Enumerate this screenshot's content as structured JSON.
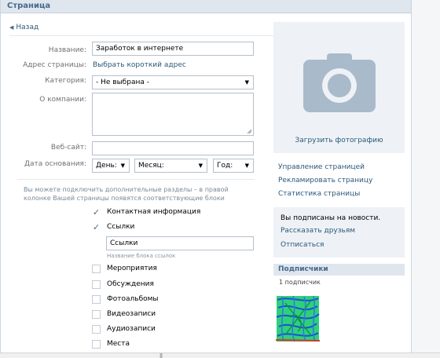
{
  "header": {
    "title": "Страница"
  },
  "back": {
    "label": "Назад"
  },
  "form": {
    "name_label": "Название:",
    "name_value": "Заработок в интернете",
    "address_label": "Адрес страницы:",
    "address_link": "Выбрать короткий адрес",
    "category_label": "Категория:",
    "category_value": "- Не выбрана -",
    "about_label": "О компании:",
    "website_label": "Веб-сайт:",
    "founded_label": "Дата основания:",
    "day": "День:",
    "month": "Месяц:",
    "year": "Год:"
  },
  "hint": "Вы можете подключить дополнительные разделы – в правой колонке Вашей страницы появятся соответствующие блоки",
  "sections": [
    {
      "label": "Контактная информация",
      "checked": true
    },
    {
      "label": "Ссылки",
      "checked": true
    },
    {
      "label": "Мероприятия",
      "checked": false
    },
    {
      "label": "Обсуждения",
      "checked": false
    },
    {
      "label": "Фотоальбомы",
      "checked": false
    },
    {
      "label": "Видеозаписи",
      "checked": false
    },
    {
      "label": "Аудиозаписи",
      "checked": false
    },
    {
      "label": "Места",
      "checked": false
    }
  ],
  "links_block": {
    "value": "Ссылки",
    "note": "Название блока ссылок"
  },
  "sidebar": {
    "upload_photo": "Загрузить фотографию",
    "manage": "Управление страницей",
    "advertise": "Рекламировать страницу",
    "stats": "Статистика страницы",
    "subscribed": "Вы подписаны на новости.",
    "tell_friends": "Рассказать друзьям",
    "unsubscribe": "Отписаться",
    "followers_title": "Подписчики",
    "followers_count": "1 подписчик"
  },
  "icons": [
    "back-arrow-icon",
    "camera-icon",
    "chevron-down-icon",
    "checkmark-icon"
  ],
  "colors": {
    "accent": "#2b587a",
    "header_bg": "#dfe6ee",
    "panel_bg": "#eef2f6"
  }
}
